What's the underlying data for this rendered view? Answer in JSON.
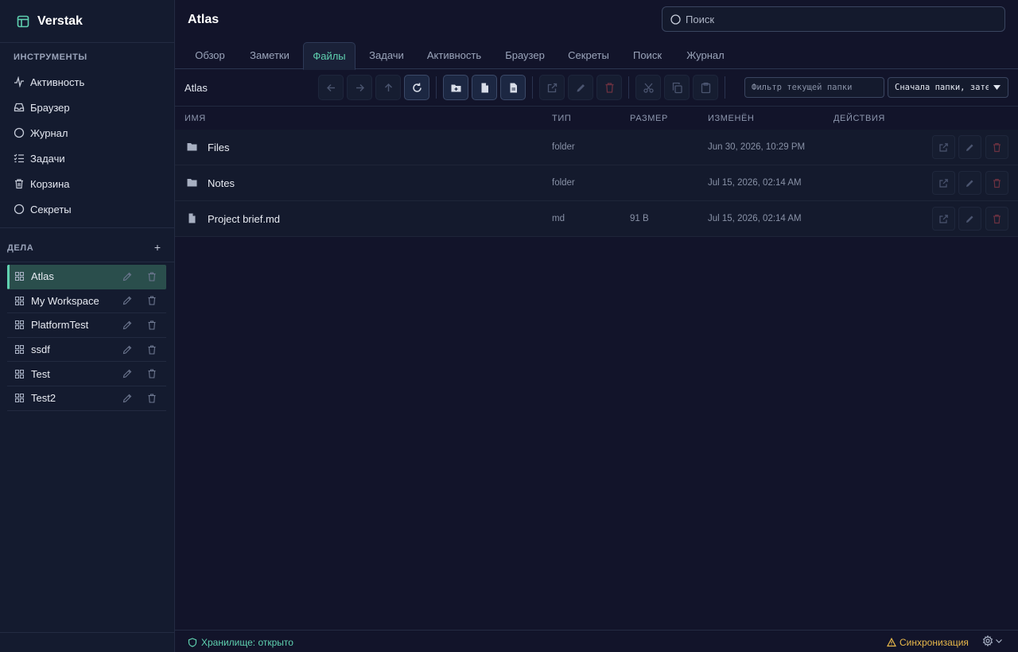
{
  "app": {
    "brand": "Verstak"
  },
  "sidebar": {
    "tools_heading": "ИНСТРУМЕНТЫ",
    "tools": [
      {
        "label": "Активность",
        "icon": "activity-icon"
      },
      {
        "label": "Браузер",
        "icon": "inbox-icon"
      },
      {
        "label": "Журнал",
        "icon": "circle-icon"
      },
      {
        "label": "Задачи",
        "icon": "checklist-icon"
      },
      {
        "label": "Корзина",
        "icon": "trash-icon"
      },
      {
        "label": "Секреты",
        "icon": "circle-icon"
      }
    ],
    "cases_heading": "ДЕЛА",
    "cases_add": "+",
    "cases": [
      {
        "label": "Atlas",
        "active": true
      },
      {
        "label": "My Workspace",
        "active": false
      },
      {
        "label": "PlatformTest",
        "active": false
      },
      {
        "label": "ssdf",
        "active": false
      },
      {
        "label": "Test",
        "active": false
      },
      {
        "label": "Test2",
        "active": false
      }
    ]
  },
  "header": {
    "title": "Atlas",
    "search_placeholder": "Поиск"
  },
  "tabs": [
    {
      "label": "Обзор",
      "active": false
    },
    {
      "label": "Заметки",
      "active": false
    },
    {
      "label": "Файлы",
      "active": true
    },
    {
      "label": "Задачи",
      "active": false
    },
    {
      "label": "Активность",
      "active": false
    },
    {
      "label": "Браузер",
      "active": false
    },
    {
      "label": "Секреты",
      "active": false
    },
    {
      "label": "Поиск",
      "active": false
    },
    {
      "label": "Журнал",
      "active": false
    }
  ],
  "toolbar": {
    "path": "Atlas",
    "filter_placeholder": "Фильтр текущей папки",
    "sort_value": "Сначала папки, затем по имени"
  },
  "table": {
    "columns": {
      "name": "ИМЯ",
      "type": "ТИП",
      "size": "РАЗМЕР",
      "modified": "ИЗМЕНЁН",
      "actions": "ДЕЙСТВИЯ"
    },
    "rows": [
      {
        "name": "Files",
        "kind": "folder",
        "type": "folder",
        "size": "",
        "modified": "Jun 30, 2026, 10:29 PM"
      },
      {
        "name": "Notes",
        "kind": "folder",
        "type": "folder",
        "size": "",
        "modified": "Jul 15, 2026, 02:14 AM"
      },
      {
        "name": "Project brief.md",
        "kind": "file",
        "type": "md",
        "size": "91 B",
        "modified": "Jul 15, 2026, 02:14 AM"
      }
    ]
  },
  "status": {
    "vault": "Хранилище: открыто",
    "sync": "Синхронизация"
  },
  "colors": {
    "accent": "#5fd1b0",
    "warning": "#e8b84a",
    "danger": "#6b3140",
    "background": "#12142a"
  }
}
